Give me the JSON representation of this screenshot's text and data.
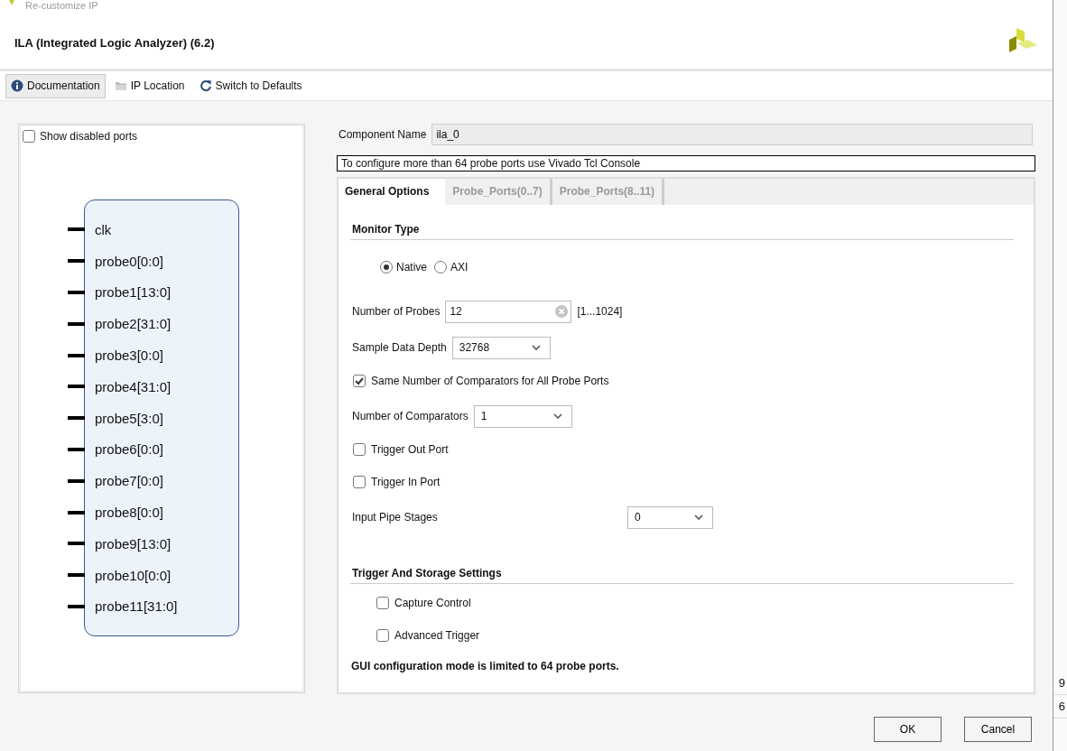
{
  "window": {
    "title": "Re-customize IP"
  },
  "header": {
    "title": "ILA (Integrated Logic Analyzer) (6.2)"
  },
  "toolbar": [
    {
      "label": "Documentation",
      "pressed": true
    },
    {
      "label": "IP Location",
      "pressed": false
    },
    {
      "label": "Switch to Defaults",
      "pressed": false
    }
  ],
  "symbol": {
    "show_disabled_ports": {
      "label": "Show disabled ports",
      "checked": false
    },
    "ports": [
      "clk",
      "probe0[0:0]",
      "probe1[13:0]",
      "probe2[31:0]",
      "probe3[0:0]",
      "probe4[31:0]",
      "probe5[3:0]",
      "probe6[0:0]",
      "probe7[0:0]",
      "probe8[0:0]",
      "probe9[13:0]",
      "probe10[0:0]",
      "probe11[31:0]"
    ]
  },
  "component_name": {
    "label": "Component Name",
    "value": "ila_0"
  },
  "note": "To configure more than 64 probe ports use Vivado Tcl Console",
  "tabs": [
    {
      "label": "General Options",
      "selected": true
    },
    {
      "label": "Probe_Ports(0..7)",
      "selected": false
    },
    {
      "label": "Probe_Ports(8..11)",
      "selected": false
    }
  ],
  "general_options": [
    {
      "kind": "section",
      "label": "Monitor Type"
    },
    {
      "kind": "radio",
      "options": [
        {
          "label": "Native",
          "selected": true
        },
        {
          "label": "AXI",
          "selected": false
        }
      ]
    },
    {
      "kind": "text_field",
      "label": "Number of Probes",
      "value": "12",
      "range": "[1...1024]"
    },
    {
      "kind": "dropdown",
      "label": "Sample Data Depth",
      "value": "32768",
      "aligned": false
    },
    {
      "kind": "checkbox",
      "label": "Same Number of Comparators for All Probe Ports",
      "checked": true,
      "indented": false
    },
    {
      "kind": "dropdown",
      "label": "Number of Comparators",
      "value": "1",
      "aligned": false
    },
    {
      "kind": "checkbox",
      "label": "Trigger Out Port",
      "checked": false,
      "indented": false
    },
    {
      "kind": "checkbox",
      "label": "Trigger In Port",
      "checked": false,
      "indented": false
    },
    {
      "kind": "dropdown",
      "label": "Input Pipe Stages",
      "value": "0",
      "aligned": true
    },
    {
      "kind": "section",
      "label": "Trigger And Storage Settings"
    },
    {
      "kind": "checkbox",
      "label": "Capture Control",
      "checked": false,
      "indented": true
    },
    {
      "kind": "checkbox",
      "label": "Advanced Trigger",
      "checked": false,
      "indented": true
    },
    {
      "kind": "note",
      "label": "GUI configuration mode is limited to 64 probe ports."
    }
  ],
  "buttons": [
    {
      "label": "OK"
    },
    {
      "label": "Cancel"
    }
  ],
  "background_window": {
    "cells": [
      "9",
      "6"
    ]
  }
}
